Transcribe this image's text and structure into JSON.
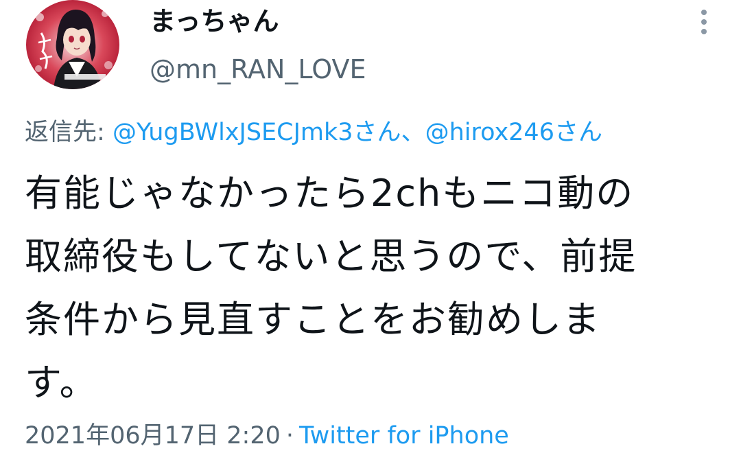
{
  "author": {
    "display_name": "まっちゃん",
    "handle": "@mn_RAN_LOVE",
    "avatar_icon": "anime-avatar-icon"
  },
  "header": {
    "more_icon": "vertical-dots-icon"
  },
  "reply": {
    "prefix": "返信先:",
    "mentions": [
      "@YugBWlxJSECJmk3さん",
      "@hirox246さん"
    ],
    "separator": "、"
  },
  "tweet": {
    "lines": [
      "有能じゃなかったら2chもニコ動の",
      "取締役もしてないと思うので、前提",
      "条件から見直すことをお勧めしま",
      "す。"
    ]
  },
  "meta": {
    "timestamp": "2021年06月17日 2:20",
    "dot": "·",
    "source": "Twitter for iPhone"
  },
  "colors": {
    "link": "#1d9bf0",
    "secondary": "#536471",
    "primary": "#0f1419",
    "avatar_bg": "#c8102e"
  }
}
